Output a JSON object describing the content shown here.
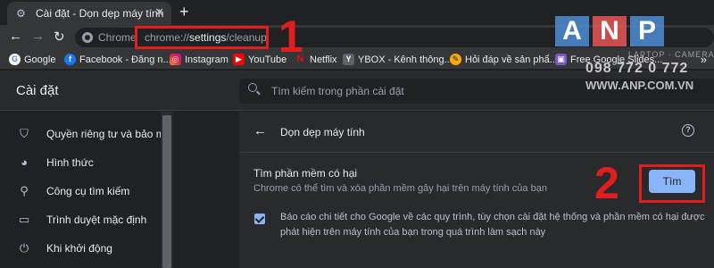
{
  "tab": {
    "title": "Cài đặt - Dọn dẹp máy tính",
    "favicon": "gear-icon",
    "close": "✕"
  },
  "new_tab": "+",
  "omnibox": {
    "site_chip": "Chrome",
    "url_prefix": "chrome://",
    "url_host": "settings",
    "url_path": "/cleanup"
  },
  "bookmarks": [
    {
      "label": "Google",
      "icon": "google-icon",
      "glyph": "G"
    },
    {
      "label": "Facebook - Đăng n...",
      "icon": "facebook-icon",
      "glyph": "f"
    },
    {
      "label": "Instagram",
      "icon": "instagram-icon",
      "glyph": "◎"
    },
    {
      "label": "YouTube",
      "icon": "youtube-icon",
      "glyph": "▶"
    },
    {
      "label": "Netflix",
      "icon": "netflix-icon",
      "glyph": "N"
    },
    {
      "label": "YBOX - Kênh thông...",
      "icon": "ybox-icon",
      "glyph": "Y"
    },
    {
      "label": "Hỏi đáp về sản phẩ...",
      "icon": "hoidap-icon",
      "glyph": "✎"
    },
    {
      "label": "Free Google Slides...",
      "icon": "slides-icon",
      "glyph": "▣"
    }
  ],
  "bookmarks_more": "»",
  "settings": {
    "title": "Cài đặt",
    "search_placeholder": "Tìm kiếm trong phần cài đặt"
  },
  "sidebar": {
    "items": [
      {
        "label": "Quyền riêng tư và bảo mật",
        "icon": "shield-icon",
        "glyph": "⛉"
      },
      {
        "label": "Hình thức",
        "icon": "palette-icon",
        "glyph": "◕"
      },
      {
        "label": "Công cụ tìm kiếm",
        "icon": "search-icon",
        "glyph": "⚲"
      },
      {
        "label": "Trình duyệt mặc định",
        "icon": "browser-icon",
        "glyph": "▭"
      },
      {
        "label": "Khi khởi động",
        "icon": "power-icon",
        "glyph": "⏻"
      }
    ]
  },
  "card": {
    "title": "Dọn dẹp máy tính",
    "help": "?",
    "section_title": "Tìm phần mềm có hại",
    "section_desc": "Chrome có thể tìm và xóa phần mềm gây hại trên máy tính của bạn",
    "find_button": "Tìm",
    "report_checked": true,
    "report_text": "Báo cáo chi tiết cho Google về các quy trình, tùy chọn cài đặt hệ thống và phần mềm có hại được phát hiện trên máy tính của bạn trong quá trình làm sạch này"
  },
  "annotations": {
    "step1": "1",
    "step2": "2"
  },
  "watermark": {
    "logo": [
      "A",
      "N",
      "P"
    ],
    "tagline": "LAPTOP · CAMERA",
    "phone": "098 772 0 772",
    "url": "WWW.ANP.COM.VN"
  },
  "colors": {
    "accent": "#8ab4f8",
    "annotation": "#e01e1e",
    "background": "#202124",
    "card": "#292a2d"
  }
}
